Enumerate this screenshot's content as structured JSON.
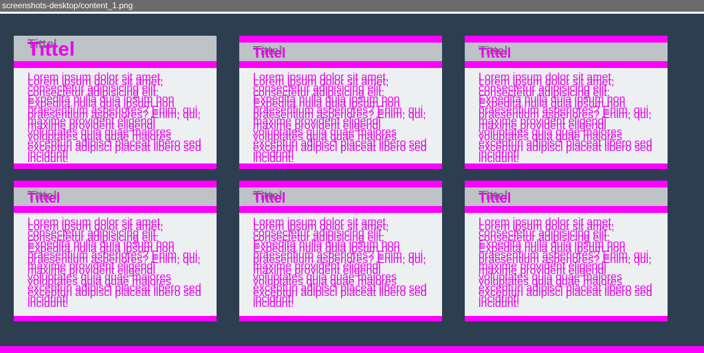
{
  "window": {
    "title": "screenshots-desktop/content_1.png"
  },
  "cards": [
    {
      "title": "Tittel",
      "body_a": "Lorem ipsum dolor sit amet,\nconsectetur adipisicing elit.\nExpedita nulla quia ipsum non\npraesentium asperiores? Enim, qui,\nmaxime provident eligendi\nvoluptates quia quae maiores\nexcepturi adipisci placeat libero sed\nincidunt!",
      "body_b": "Lorem ipsum dolor sit amet,\nconsectetur adipisicing elit.\nExpedita nulla quia ipsum non\npraesentium asperiores? Enim, qui,\nmaxime provident eligendi\nvoluptates quia quae maiores\nexcepturi adipisci placeat libero sed\nincidunt!"
    }
  ],
  "colors": {
    "background": "#2c3e50",
    "accent": "#ff00ff",
    "card": "#ecf0f1",
    "card_header": "#bdc3c7"
  }
}
